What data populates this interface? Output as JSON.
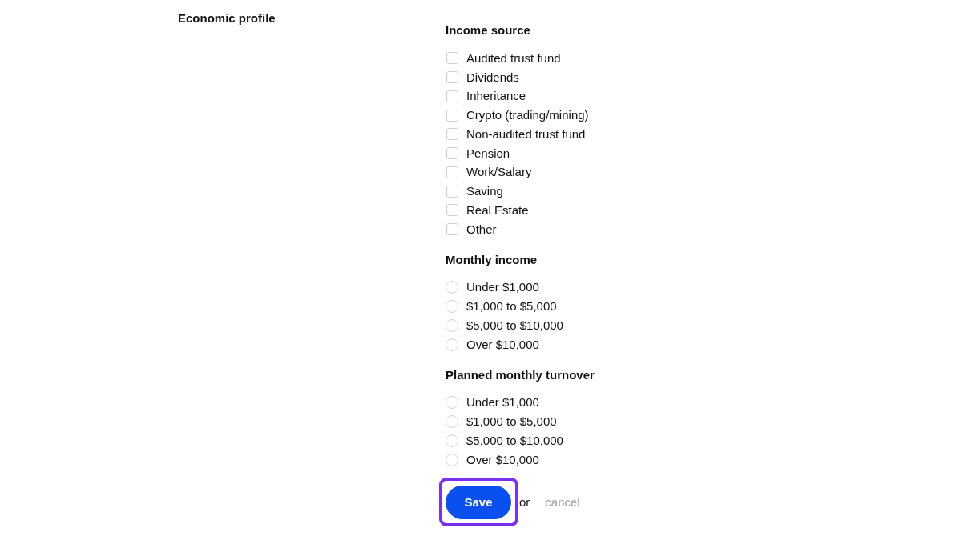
{
  "section_title": "Economic profile",
  "groups": [
    {
      "kind": "checkbox",
      "title": "Income source",
      "options": [
        {
          "label": "Audited trust fund",
          "checked": false
        },
        {
          "label": "Dividends",
          "checked": false
        },
        {
          "label": "Inheritance",
          "checked": false
        },
        {
          "label": "Crypto (trading/mining)",
          "checked": false
        },
        {
          "label": "Non-audited trust fund",
          "checked": false
        },
        {
          "label": "Pension",
          "checked": false
        },
        {
          "label": "Work/Salary",
          "checked": false
        },
        {
          "label": "Saving",
          "checked": false
        },
        {
          "label": "Real Estate",
          "checked": false
        },
        {
          "label": "Other",
          "checked": false
        }
      ]
    },
    {
      "kind": "radio",
      "title": "Monthly income",
      "options": [
        {
          "label": "Under $1,000",
          "selected": false
        },
        {
          "label": "$1,000 to $5,000",
          "selected": false
        },
        {
          "label": "$5,000 to $10,000",
          "selected": false
        },
        {
          "label": "Over $10,000",
          "selected": false
        }
      ]
    },
    {
      "kind": "radio",
      "title": "Planned monthly turnover",
      "options": [
        {
          "label": "Under $1,000",
          "selected": false
        },
        {
          "label": "$1,000 to $5,000",
          "selected": false
        },
        {
          "label": "$5,000 to $10,000",
          "selected": false
        },
        {
          "label": "Over $10,000",
          "selected": false
        }
      ]
    }
  ],
  "actions": {
    "save": {
      "label": "Save",
      "highlighted": true
    },
    "separator": "or",
    "cancel": "cancel"
  }
}
